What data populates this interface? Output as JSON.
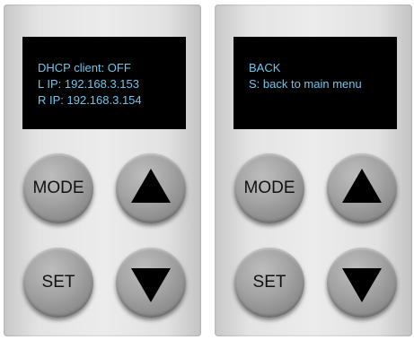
{
  "left_panel": {
    "screen_lines": [
      "DHCP client: OFF",
      "L IP: 192.168.3.153",
      "R IP: 192.168.3.154"
    ],
    "mode_label": "MODE",
    "set_label": "SET",
    "up_icon": "triangle-up-icon",
    "down_icon": "triangle-down-icon"
  },
  "right_panel": {
    "screen_lines": [
      "BACK",
      "S: back to main menu"
    ],
    "mode_label": "MODE",
    "set_label": "SET",
    "up_icon": "triangle-up-icon",
    "down_icon": "triangle-down-icon"
  },
  "colors": {
    "screen_text": "#6ec6ee",
    "screen_background": "#000000",
    "panel": "#e4e4e4",
    "button": "#a4a4a4"
  }
}
